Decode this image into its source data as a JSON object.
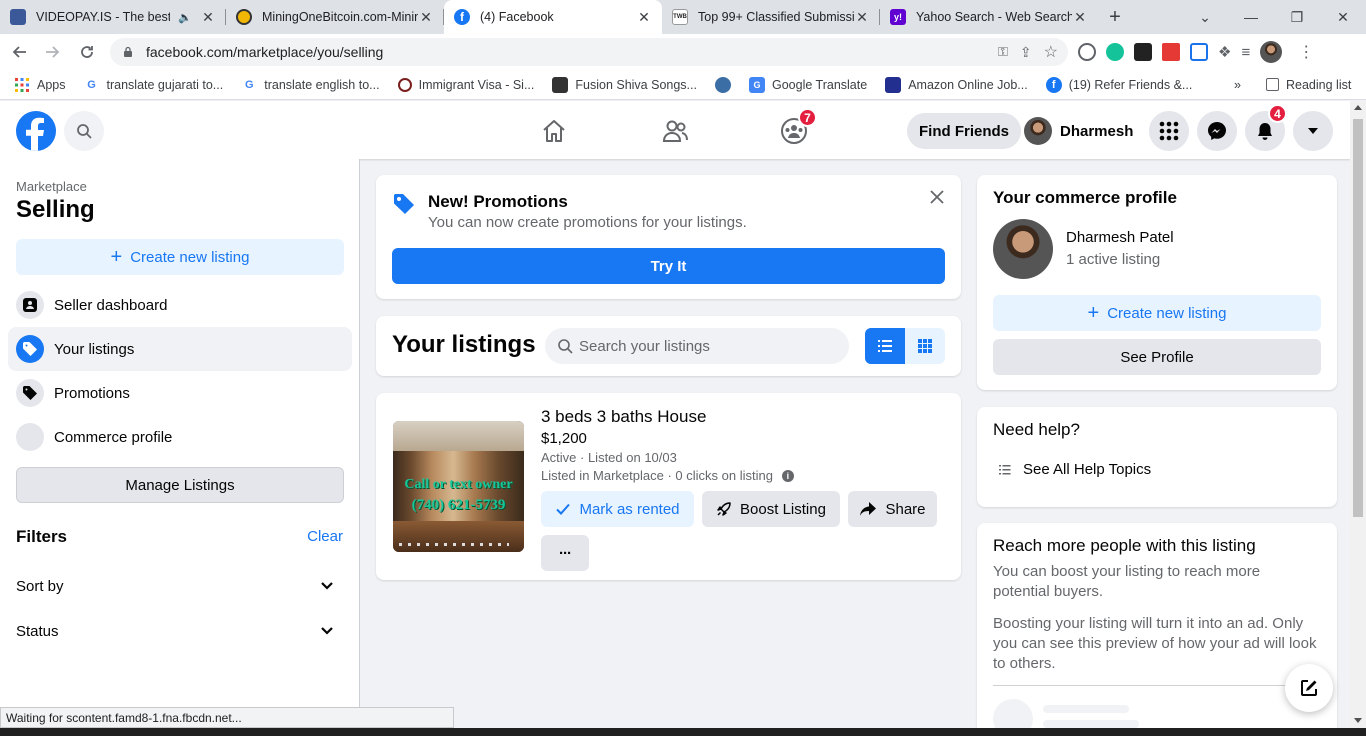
{
  "browser": {
    "tabs": [
      {
        "title": "VIDEOPAY.IS - The best w",
        "fav_color": "#3b5998",
        "fav_text": ""
      },
      {
        "title": "MiningOneBitcoin.com-Minin",
        "fav_color": "#f2b705",
        "fav_text": ""
      },
      {
        "title": "(4) Facebook",
        "fav_color": "#1877f2",
        "fav_text": "f"
      },
      {
        "title": "Top 99+ Classified Submissio",
        "fav_color": "#444444",
        "fav_text": "TWB"
      },
      {
        "title": "Yahoo Search - Web Search",
        "fav_color": "#6001d2",
        "fav_text": "y!"
      }
    ],
    "url": "facebook.com/marketplace/you/selling",
    "bookmarks": [
      {
        "label": "Apps",
        "color": "#4285f4"
      },
      {
        "label": "translate gujarati to...",
        "color": "#4285f4"
      },
      {
        "label": "translate english to...",
        "color": "#4285f4"
      },
      {
        "label": "Immigrant Visa - Si...",
        "color": "#7a1e1e"
      },
      {
        "label": "Fusion Shiva Songs...",
        "color": "#333333"
      },
      {
        "label": "",
        "color": "#3a6ea5"
      },
      {
        "label": "Google Translate",
        "color": "#4285f4"
      },
      {
        "label": "Amazon Online Job...",
        "color": "#232f8e"
      },
      {
        "label": "(19) Refer Friends &...",
        "color": "#1877f2"
      }
    ],
    "reading_list": "Reading list",
    "status_text": "Waiting for scontent.famd8-1.fna.fbcdn.net..."
  },
  "header": {
    "groups_badge": "7",
    "find_friends": "Find Friends",
    "profile_name": "Dharmesh",
    "notifications_badge": "4"
  },
  "sidebar": {
    "breadcrumb": "Marketplace",
    "title": "Selling",
    "create_listing": "Create new listing",
    "items": [
      {
        "label": "Seller dashboard"
      },
      {
        "label": "Your listings"
      },
      {
        "label": "Promotions"
      },
      {
        "label": "Commerce profile"
      }
    ],
    "manage_listings": "Manage Listings",
    "filters_title": "Filters",
    "clear": "Clear",
    "sort_by": "Sort by",
    "status": "Status"
  },
  "promo": {
    "title": "New! Promotions",
    "subtitle": "You can now create promotions for your listings.",
    "button": "Try It"
  },
  "listings": {
    "title": "Your listings",
    "search_placeholder": "Search your listings",
    "item": {
      "title": "3 beds 3 baths House",
      "price": "$1,200",
      "status": "Active · Listed on 10/03",
      "meta": "Listed in Marketplace · 0 clicks on listing",
      "image_text_1": "Call or text owner",
      "image_text_2": "(740) 621-5739",
      "mark_rented": "Mark as rented",
      "boost": "Boost Listing",
      "share": "Share",
      "more": "···"
    }
  },
  "commerce": {
    "title": "Your commerce profile",
    "name": "Dharmesh Patel",
    "listings_count": "1 active listing",
    "create_listing": "Create new listing",
    "see_profile": "See Profile"
  },
  "help": {
    "title": "Need help?",
    "link": "See All Help Topics"
  },
  "reach": {
    "title": "Reach more people with this listing",
    "text1": "You can boost your listing to reach more potential buyers.",
    "text2": "Boosting your listing will turn it into an ad. Only you can see this preview of how your ad will look to others."
  },
  "colors": {
    "fb_blue": "#1877f2",
    "light_blue": "#e7f3ff",
    "grey_button": "#e4e6eb",
    "badge_red": "#e41e3f"
  }
}
